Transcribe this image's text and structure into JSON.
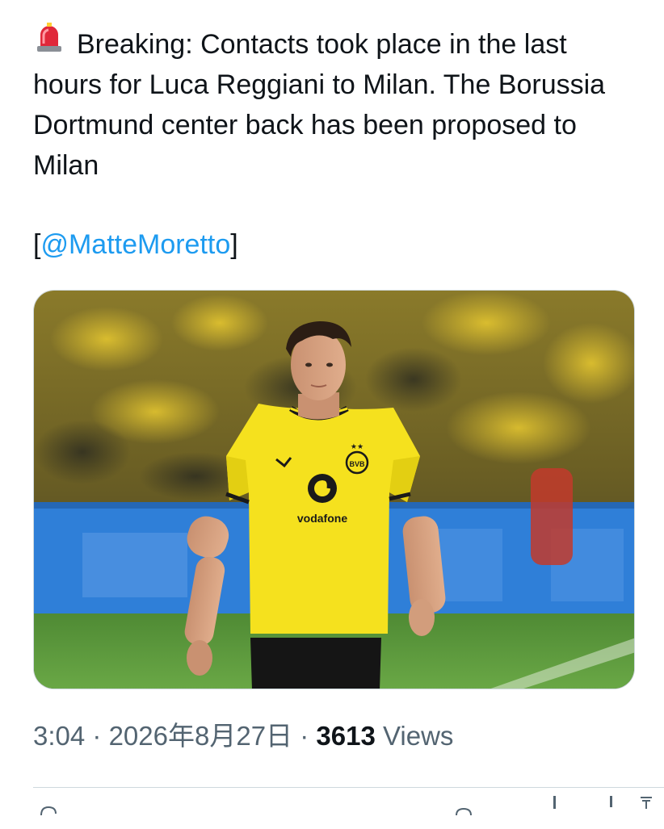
{
  "tweet": {
    "emoji_icon": "police-car-light-icon",
    "text": "Breaking: Contacts took place in the last hours for Luca Reggiani to Milan. The Borussia Dortmund center back has been proposed to Milan",
    "source_open": "[",
    "source_mention": "@MatteMoretto",
    "source_close": "]"
  },
  "media": {
    "description_icon": "player-photo",
    "shirt_sponsor": "vodafone",
    "badge_text": "BVB 09",
    "colors": {
      "jersey": "#f5e11e",
      "pitch": "#4f8a34",
      "board": "#2f7fd8"
    }
  },
  "meta": {
    "time": "3:04",
    "separator": "·",
    "date": "2026年8月27日",
    "views_count": "3613",
    "views_label": "Views"
  },
  "colors": {
    "accent": "#1d9bf0",
    "text": "#0f1419",
    "secondary": "#536471",
    "border": "#cfd9de"
  }
}
